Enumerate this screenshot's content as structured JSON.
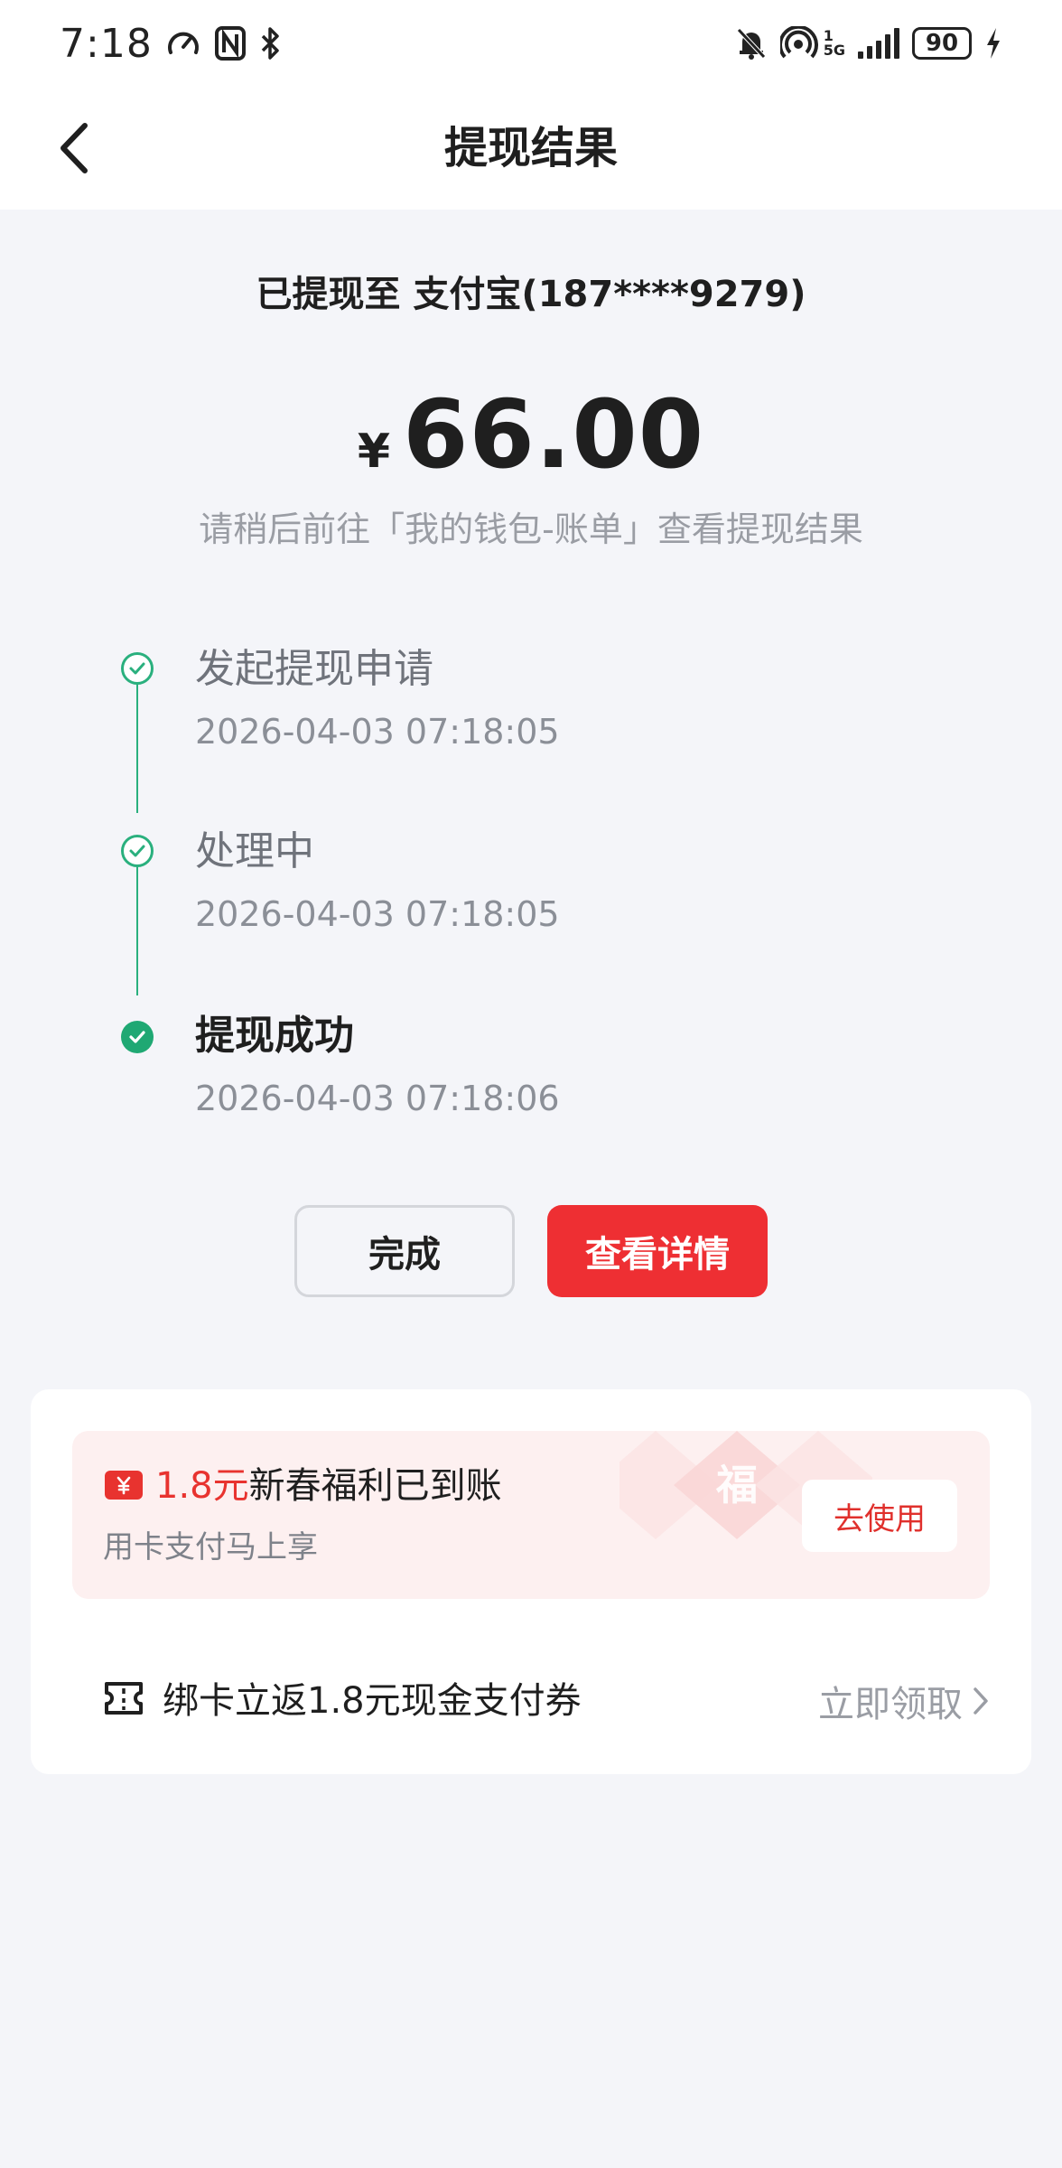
{
  "status_bar": {
    "time": "7:18",
    "network": "5G",
    "network_sub": "1",
    "battery": "90"
  },
  "nav": {
    "title": "提现结果"
  },
  "result": {
    "destination": "已提现至 支付宝(187****9279)",
    "currency": "¥",
    "amount": "66.00",
    "hint": "请稍后前往「我的钱包-账单」查看提现结果"
  },
  "timeline": {
    "steps": [
      {
        "title": "发起提现申请",
        "time": "2026-04-03 07:18:05",
        "state": "done"
      },
      {
        "title": "处理中",
        "time": "2026-04-03 07:18:05",
        "state": "done"
      },
      {
        "title": "提现成功",
        "time": "2026-04-03 07:18:06",
        "state": "current"
      }
    ]
  },
  "buttons": {
    "done": "完成",
    "detail": "查看详情"
  },
  "promo": {
    "amount": "1.8元",
    "text": "新春福利已到账",
    "sub": "用卡支付马上享",
    "action": "去使用",
    "deco_char": "福"
  },
  "bind": {
    "text": "绑卡立返1.8元现金支付券",
    "action": "立即领取"
  },
  "colors": {
    "accent_green": "#1fa873",
    "accent_red": "#ee2f33",
    "background": "#f4f5f9"
  }
}
